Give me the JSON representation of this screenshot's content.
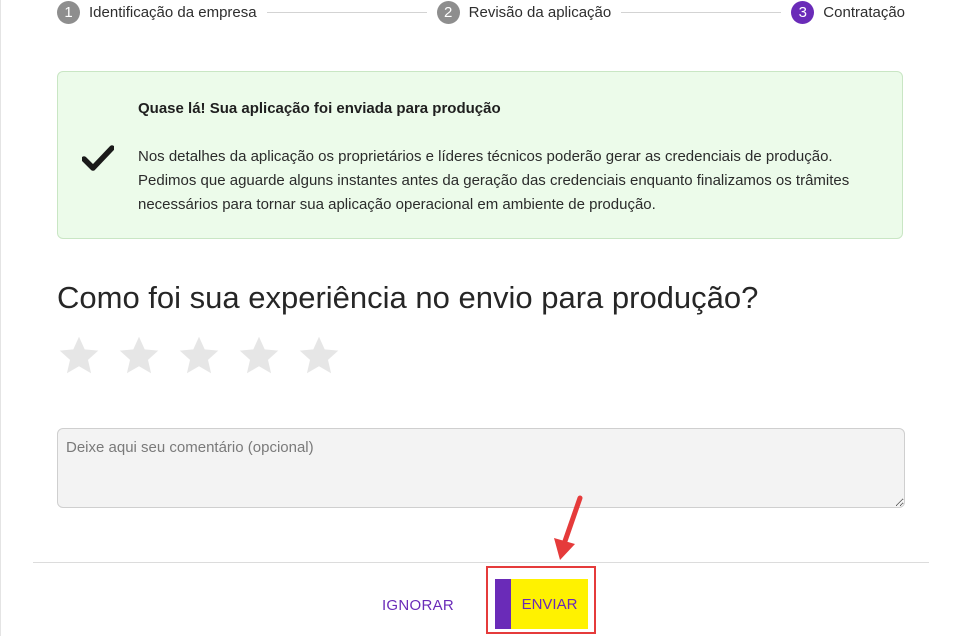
{
  "stepper": {
    "steps": [
      {
        "number": "1",
        "label": "Identificação da empresa",
        "state": "done"
      },
      {
        "number": "2",
        "label": "Revisão da aplicação",
        "state": "done"
      },
      {
        "number": "3",
        "label": "Contratação",
        "state": "active"
      }
    ]
  },
  "alert": {
    "title": "Quase lá! Sua aplicação foi enviada para produção",
    "body": "Nos detalhes da aplicação os proprietários e líderes técnicos poderão gerar as credenciais de produção. Pedimos que aguarde alguns instantes antes da geração das credenciais enquanto finalizamos os trâmites necessários para tornar sua aplicação operacional em ambiente de produção.",
    "icon": "check-icon",
    "background_color": "#ecfbea"
  },
  "feedback": {
    "question": "Como foi sua experiência no envio para produção?",
    "rating": {
      "value": 0,
      "max": 5,
      "icon": "star-icon",
      "empty_color": "#e6e6e6"
    },
    "comment": {
      "placeholder": "Deixe aqui seu comentário (opcional)",
      "value": ""
    }
  },
  "actions": {
    "ignore_label": "IGNORAR",
    "send_label": "ENVIAR"
  },
  "colors": {
    "accent": "#6a2bb8",
    "button_yellow": "#fff200",
    "annotation_red": "#e53b3b"
  }
}
